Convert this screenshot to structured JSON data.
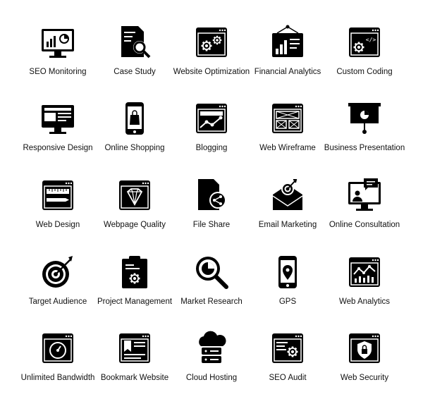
{
  "icon_color": "#000000",
  "icons": [
    {
      "label": "SEO Monitoring",
      "icon": "monitor-chart-icon"
    },
    {
      "label": "Case Study",
      "icon": "document-search-icon"
    },
    {
      "label": "Website Optimization",
      "icon": "browser-gears-icon"
    },
    {
      "label": "Financial Analytics",
      "icon": "board-chart-icon"
    },
    {
      "label": "Custom Coding",
      "icon": "browser-code-gear-icon"
    },
    {
      "label": "Responsive Design",
      "icon": "monitor-layout-icon"
    },
    {
      "label": "Online Shopping",
      "icon": "phone-bag-icon"
    },
    {
      "label": "Blogging",
      "icon": "browser-line-graph-icon"
    },
    {
      "label": "Web Wireframe",
      "icon": "browser-wireframe-icon"
    },
    {
      "label": "Business Presentation",
      "icon": "presentation-board-icon"
    },
    {
      "label": "Web Design",
      "icon": "browser-ruler-pencil-icon"
    },
    {
      "label": "Webpage Quality",
      "icon": "browser-diamond-icon"
    },
    {
      "label": "File Share",
      "icon": "file-share-icon"
    },
    {
      "label": "Email Marketing",
      "icon": "envelope-target-icon"
    },
    {
      "label": "Online Consultation",
      "icon": "monitor-chat-user-icon"
    },
    {
      "label": "Target Audience",
      "icon": "target-arrow-icon"
    },
    {
      "label": "Project Management",
      "icon": "clipboard-gear-icon"
    },
    {
      "label": "Market Research",
      "icon": "magnifier-pie-icon"
    },
    {
      "label": "GPS",
      "icon": "phone-location-icon"
    },
    {
      "label": "Web Analytics",
      "icon": "browser-analytics-icon"
    },
    {
      "label": "Unlimited Bandwidth",
      "icon": "browser-speedometer-icon"
    },
    {
      "label": "Bookmark Website",
      "icon": "browser-bookmark-icon"
    },
    {
      "label": "Cloud Hosting",
      "icon": "cloud-server-icon"
    },
    {
      "label": "SEO Audit",
      "icon": "browser-list-gear-icon"
    },
    {
      "label": "Web Security",
      "icon": "browser-shield-lock-icon"
    }
  ]
}
